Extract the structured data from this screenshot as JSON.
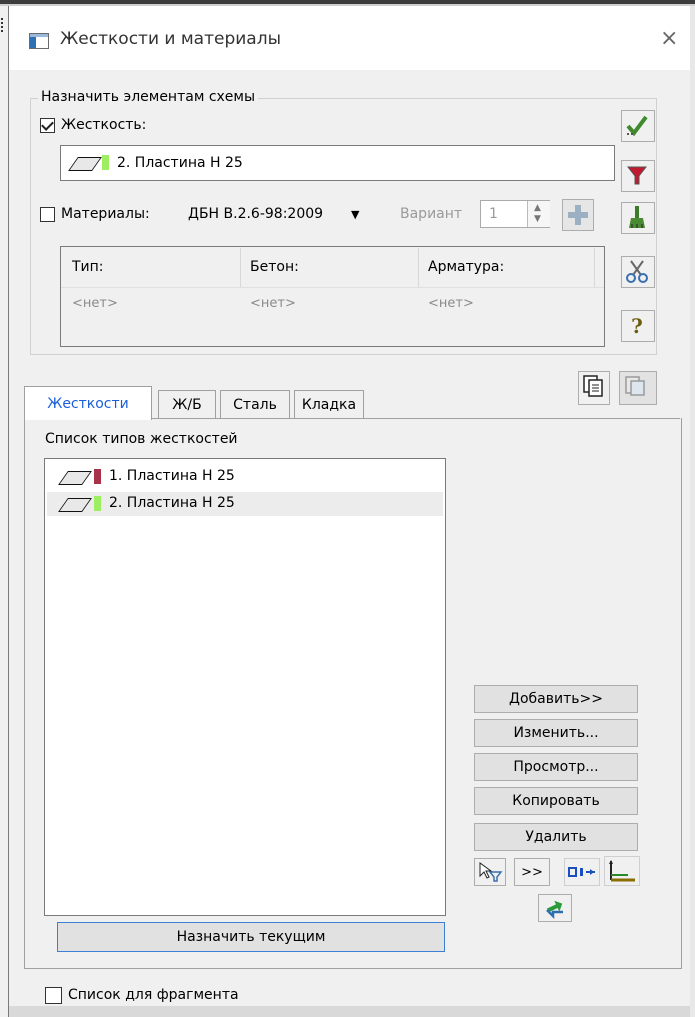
{
  "window": {
    "title": "Жесткости и материалы",
    "close": "×"
  },
  "assign_group": {
    "legend": "Назначить элементам схемы",
    "stiffness_label": "Жесткость:",
    "stiffness_checked": true,
    "current_stiffness": "2. Пластина  Н 25",
    "current_color": "#9dee60",
    "materials_label": "Материалы:",
    "materials_checked": false,
    "norm": "ДБН В.2.6-98:2009",
    "variant_label": "Вариант",
    "variant_value": "1",
    "table": {
      "headers": [
        "Тип:",
        "Бетон:",
        "Арматура:"
      ],
      "values": [
        "<нет>",
        "<нет>",
        "<нет>"
      ]
    }
  },
  "tabs": [
    {
      "label": "Жесткости",
      "active": true
    },
    {
      "label": "Ж/Б",
      "active": false
    },
    {
      "label": "Сталь",
      "active": false
    },
    {
      "label": "Кладка",
      "active": false
    }
  ],
  "stiffness_list": {
    "title": "Список типов жесткостей",
    "items": [
      {
        "label": "1. Пластина  Н 25",
        "color": "#a8324a",
        "selected": false
      },
      {
        "label": "2. Пластина  Н 25",
        "color": "#9dee60",
        "selected": true
      }
    ]
  },
  "side_buttons": {
    "add": "Добавить>>",
    "edit": "Изменить...",
    "view": "Просмотр...",
    "copy": "Копировать",
    "delete": "Удалить",
    "next": ">>"
  },
  "assign_current": "Назначить текущим",
  "fragment_list": {
    "label": "Список для фрагмента",
    "checked": false
  },
  "icons": [
    "checkmark-icon",
    "filter-icon",
    "brush-icon",
    "scissors-icon",
    "help-icon",
    "plus-icon",
    "copy-icon",
    "paste-icon",
    "select-filter-icon",
    "dimension-icon",
    "axis-icon",
    "swap-icon"
  ]
}
